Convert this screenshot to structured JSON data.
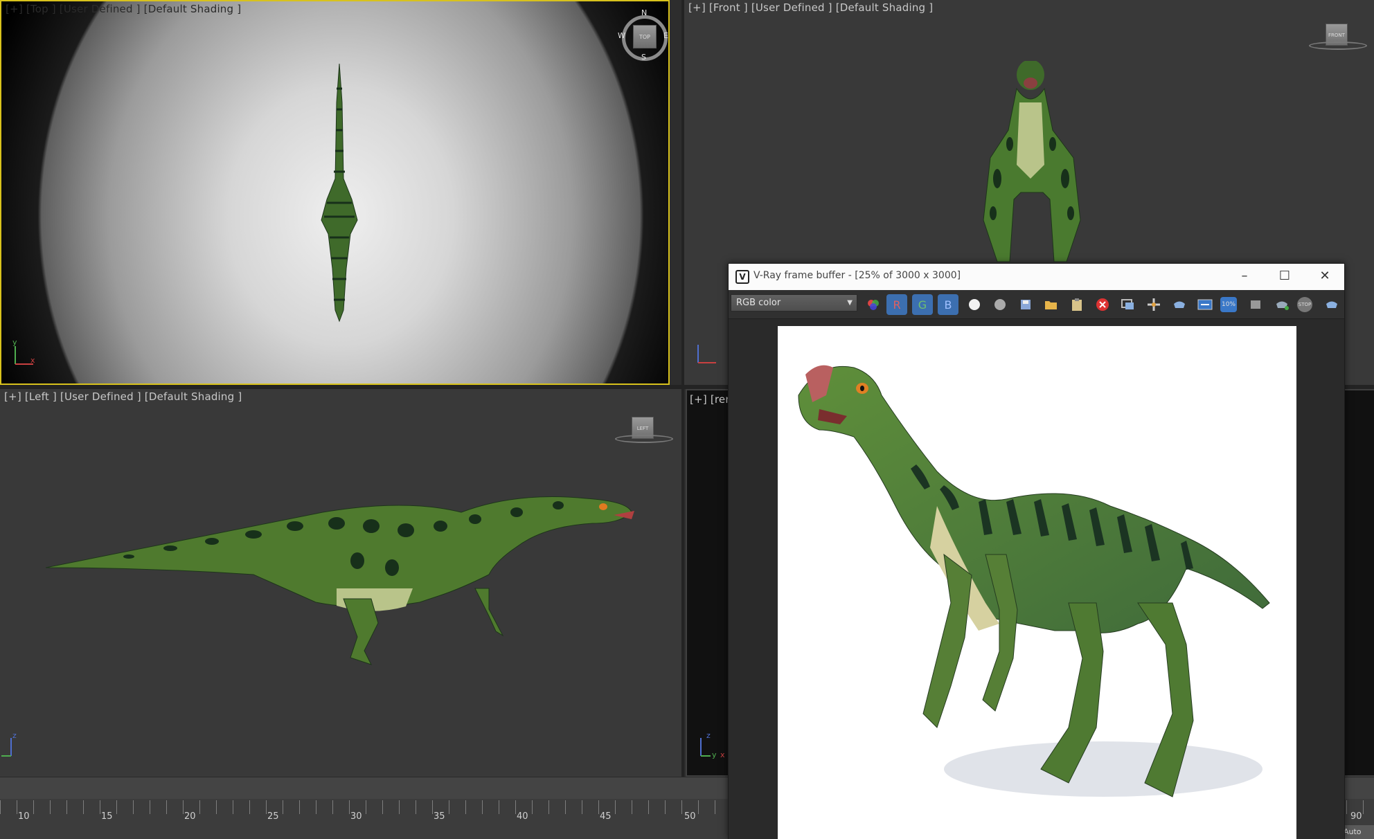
{
  "viewports": {
    "top": {
      "label": "[+] [Top ] [User Defined ] [Default Shading ]",
      "compass": {
        "n": "N",
        "s": "S",
        "e": "E",
        "w": "W"
      },
      "cube": "TOP",
      "axis_x": "x",
      "axis_y": "y"
    },
    "front": {
      "label": "[+] [Front ] [User Defined ] [Default Shading ]",
      "cube": "FRONT"
    },
    "left": {
      "label": "[+] [Left ] [User Defined ] [Default Shading ]",
      "cube": "LEFT",
      "axis_z": "z"
    },
    "render": {
      "label": "[+] [rend",
      "axis_z": "z",
      "axis_y": "y",
      "axis_x": "x"
    }
  },
  "timeline": {
    "ticks": [
      "10",
      "15",
      "20",
      "25",
      "30",
      "35",
      "40",
      "45",
      "50",
      "90"
    ],
    "auto_label": "Auto"
  },
  "vfb": {
    "logo": "V",
    "title": "V-Ray frame buffer - [25% of 3000 x 3000]",
    "minimize": "–",
    "maximize": "☐",
    "close": "✕",
    "channel_select": "RGB color",
    "channel_r": "R",
    "channel_g": "G",
    "channel_b": "B",
    "zoom_badge": "10%",
    "stop_badge": "STOP"
  },
  "colors": {
    "active_viewport_border": "#d8c21c",
    "dino_dark": "#1f3a1c",
    "dino_mid": "#4f7a2e",
    "dino_light": "#9cbf5a",
    "channel_button": "#3c6fb0"
  }
}
